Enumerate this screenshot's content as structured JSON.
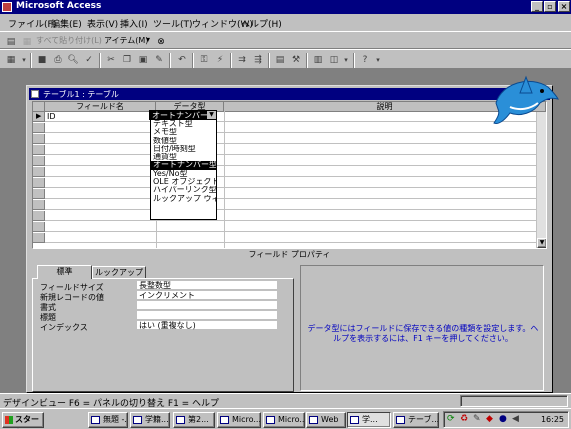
{
  "window": {
    "title": "Microsoft Access"
  },
  "menubar": [
    "ファイル(F)",
    "編集(E)",
    "表示(V)",
    "挿入(I)",
    "ツール(T)",
    "ウィンドウ(W)",
    "ヘルプ(H)"
  ],
  "toolbar1": {
    "paste_all_label": "すべて貼り付け(L)",
    "items_label": "アイテム(M)"
  },
  "child": {
    "title": "テーブル1 : テーブル"
  },
  "grid": {
    "headers": {
      "field_name": "フィールド名",
      "data_type": "データ型",
      "description": "説明"
    },
    "row1": {
      "field_name": "ID",
      "data_type": "オートナンバー型"
    }
  },
  "dropdown": {
    "options": [
      "テキスト型",
      "メモ型",
      "数値型",
      "日付/時刻型",
      "通貨型",
      "オートナンバー型",
      "Yes/No型",
      "OLE オブジェクト型",
      "ハイパーリンク型",
      "ルックアップ ウィザード..."
    ],
    "selected_index": 5
  },
  "properties": {
    "section_title": "フィールド プロパティ",
    "tabs": [
      "標準",
      "ルックアップ"
    ],
    "rows": [
      {
        "label": "フィールドサイズ",
        "value": "長整数型"
      },
      {
        "label": "新規レコードの値",
        "value": "インクリメント"
      },
      {
        "label": "書式",
        "value": ""
      },
      {
        "label": "標題",
        "value": ""
      },
      {
        "label": "インデックス",
        "value": "はい (重複なし)"
      }
    ],
    "help_text": "データ型にはフィールドに保存できる値の種類を設定します。ヘルプを表示するには、F1 キーを押してください。"
  },
  "statusbar": {
    "text": "デザインビュー  F6 = パネルの切り替え  F1 = ヘルプ"
  },
  "taskbar": {
    "start_label": "スタート",
    "tasks": [
      "無題 -...",
      "学籍...",
      "第2...",
      "Micro...",
      "Micro...",
      "Web",
      "学...",
      "テーブ..."
    ],
    "active_index": 6,
    "clock": "16:25"
  },
  "colors": {
    "titlebar": "#000080",
    "face": "#c0c0c0",
    "help_text": "#0000c0"
  }
}
